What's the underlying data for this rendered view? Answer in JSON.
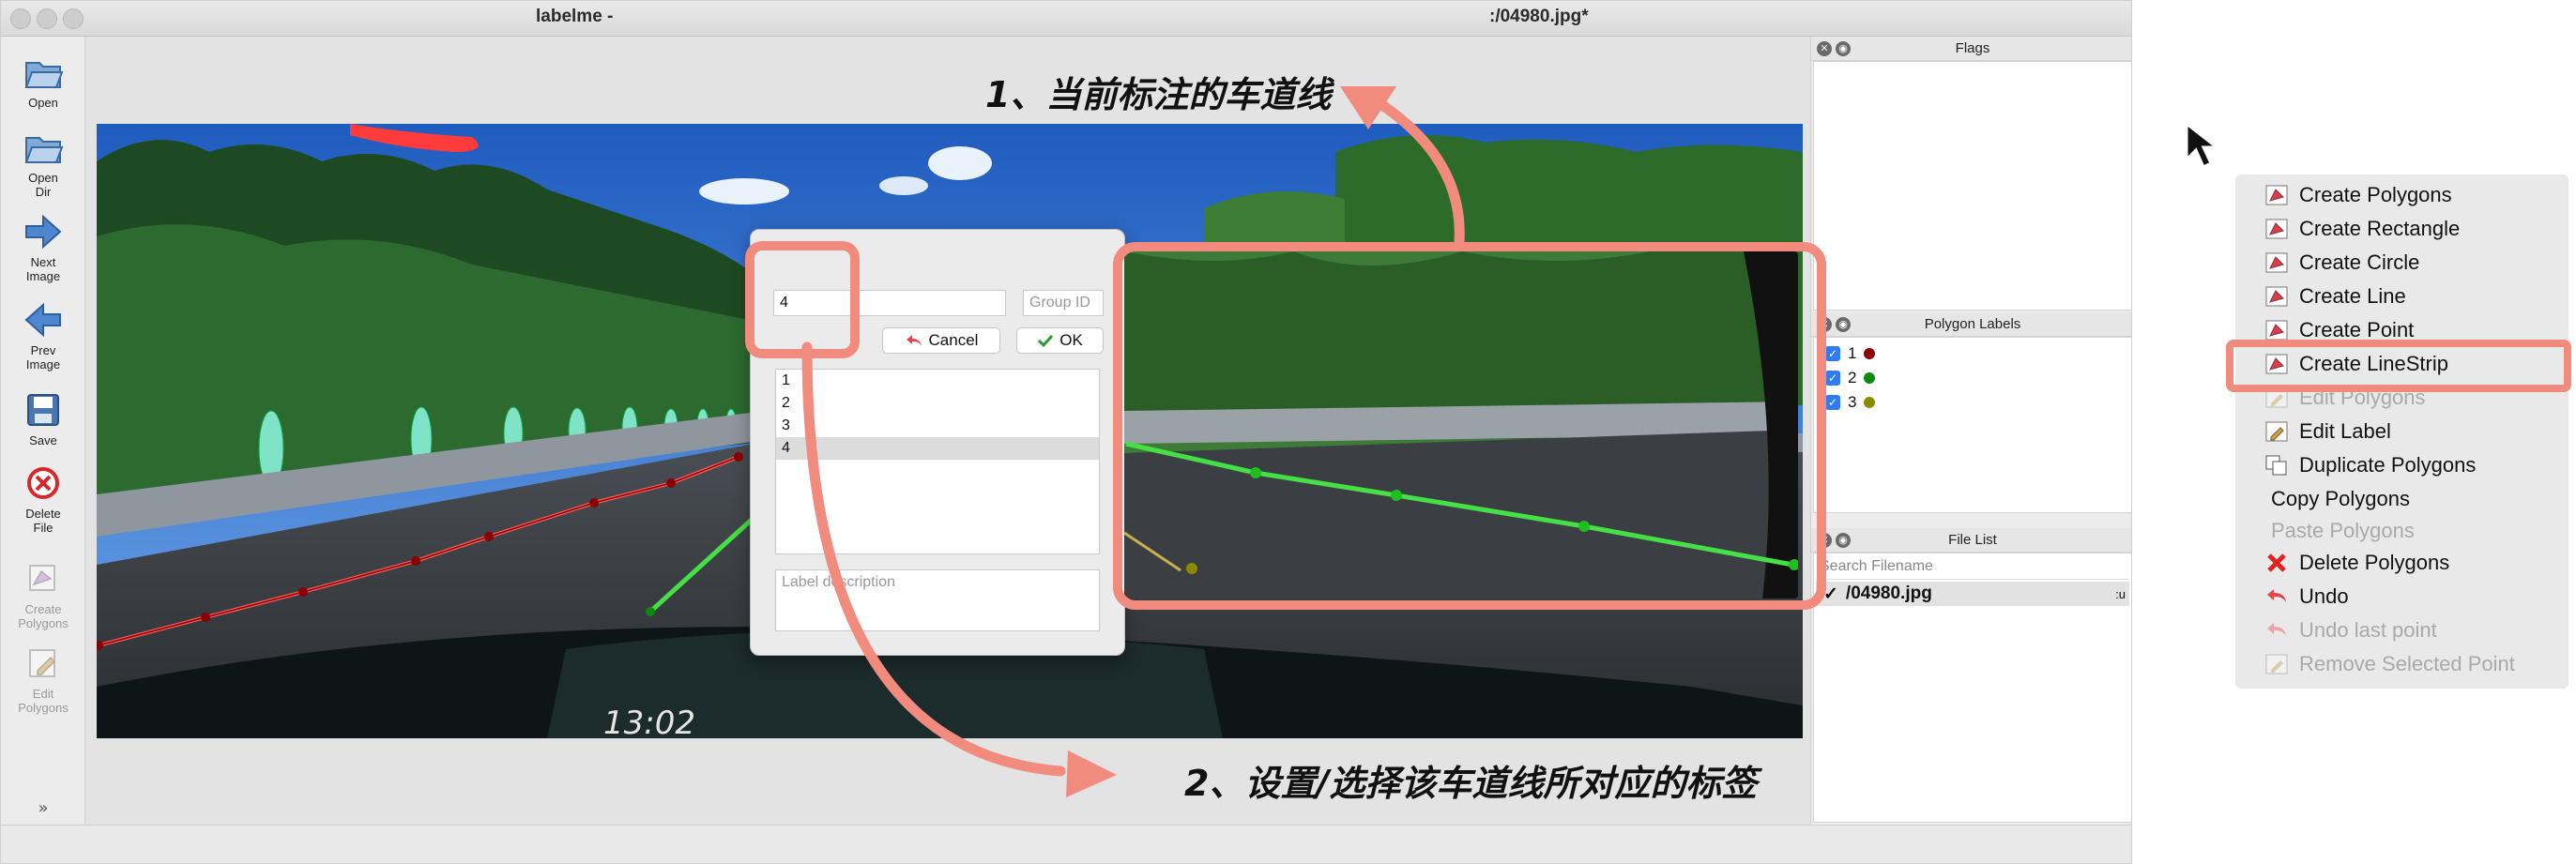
{
  "window": {
    "app_title": "labelme -",
    "file_title": ":/04980.jpg*"
  },
  "toolbar": {
    "items": [
      {
        "label": "Open",
        "icon": "folder-open-icon"
      },
      {
        "label": "Open\nDir",
        "icon": "folder-icon"
      },
      {
        "label": "Next\nImage",
        "icon": "arrow-right-icon"
      },
      {
        "label": "Prev\nImage",
        "icon": "arrow-left-icon"
      },
      {
        "label": "Save",
        "icon": "save-icon"
      },
      {
        "label": "Delete\nFile",
        "icon": "delete-icon"
      },
      {
        "label": "Create\nPolygons",
        "icon": "create-polygon-icon"
      },
      {
        "label": "Edit\nPolygons",
        "icon": "edit-icon"
      }
    ],
    "more_icon": "double-chevron-down-icon"
  },
  "canvas": {
    "clock_text": "13:02",
    "lane_colors": {
      "lane1": "#8b0000",
      "lane2": "#00a000",
      "lane3": "#8b8b00",
      "line": "#ff5a5a",
      "active": "#45e045"
    }
  },
  "dialog": {
    "label_value": "4",
    "group_id_placeholder": "Group ID",
    "cancel_label": "Cancel",
    "ok_label": "OK",
    "labels": [
      "1",
      "2",
      "3",
      "4"
    ],
    "selected_label": "4",
    "description_placeholder": "Label description"
  },
  "docks": {
    "flags_title": "Flags",
    "polygon_labels_title": "Polygon Labels",
    "polygon_labels": [
      {
        "label": "1",
        "color": "#8b0000"
      },
      {
        "label": "2",
        "color": "#0a8a0a"
      },
      {
        "label": "3",
        "color": "#8b8b00"
      }
    ],
    "file_list_title": "File List",
    "search_placeholder": "Search Filename",
    "file_item": "/04980.jpg",
    "file_item_suffix": ":u"
  },
  "context_menu": {
    "items": [
      {
        "label": "Create Polygons",
        "icon": "create-polygon-icon",
        "enabled": true
      },
      {
        "label": "Create Rectangle",
        "icon": "create-rectangle-icon",
        "enabled": true
      },
      {
        "label": "Create Circle",
        "icon": "create-circle-icon",
        "enabled": true
      },
      {
        "label": "Create Line",
        "icon": "create-line-icon",
        "enabled": true
      },
      {
        "label": "Create Point",
        "icon": "create-point-icon",
        "enabled": true
      },
      {
        "label": "Create LineStrip",
        "icon": "create-linestrip-icon",
        "enabled": true,
        "highlighted": true
      },
      {
        "label": "Edit Polygons",
        "icon": "edit-icon",
        "enabled": false
      },
      {
        "label": "Edit Label",
        "icon": "edit-label-icon",
        "enabled": true
      },
      {
        "label": "Duplicate Polygons",
        "icon": "copy-icon",
        "enabled": true
      },
      {
        "label": "Copy Polygons",
        "icon": "",
        "enabled": true
      },
      {
        "label": "Paste Polygons",
        "icon": "",
        "enabled": false
      },
      {
        "label": "Delete Polygons",
        "icon": "delete-icon",
        "enabled": true
      },
      {
        "label": "Undo",
        "icon": "undo-icon",
        "enabled": true
      },
      {
        "label": "Undo last point",
        "icon": "undo-icon",
        "enabled": false
      },
      {
        "label": "Remove Selected Point",
        "icon": "edit-icon",
        "enabled": false
      }
    ]
  },
  "annotations": {
    "callout1": "1、当前标注的车道线",
    "callout2": "2、设置/选择该车道线所对应的标签",
    "accent_color": "#f08b7d"
  }
}
